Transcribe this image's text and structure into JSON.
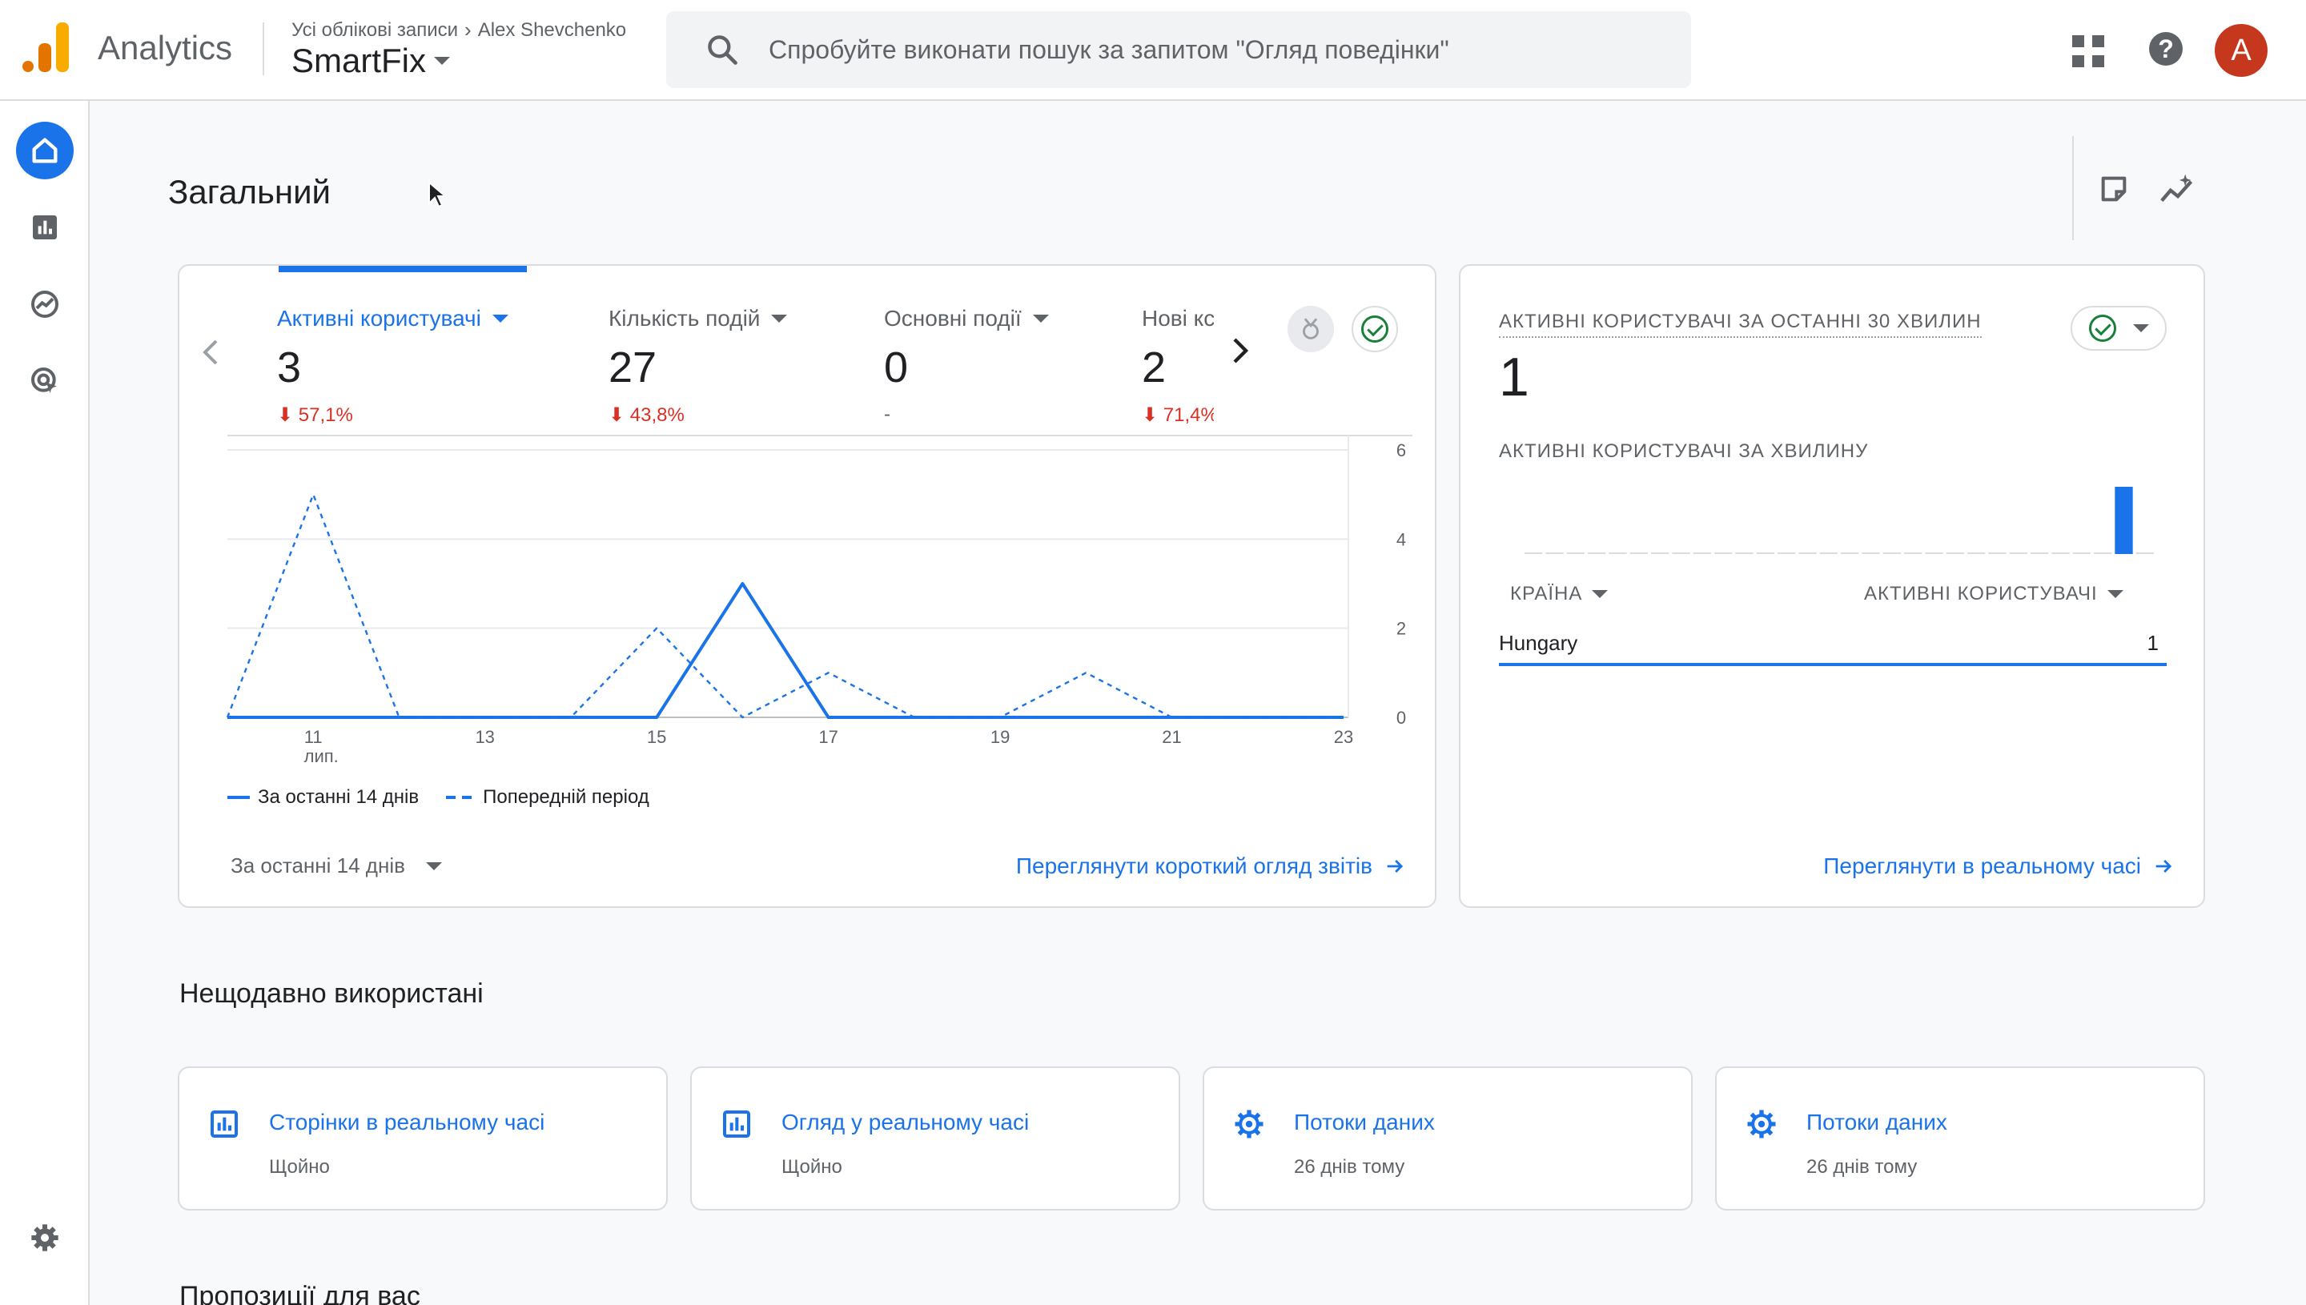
{
  "header": {
    "brand": "Analytics",
    "breadcrumb_all": "Усі облікові записи",
    "breadcrumb_account": "Alex Shevchenko",
    "property": "SmartFix",
    "search_placeholder": "Спробуйте виконати пошук за запитом \"Огляд поведінки\"",
    "avatar_letter": "A"
  },
  "page": {
    "title": "Загальний"
  },
  "metrics": [
    {
      "label": "Активні користувачі",
      "value": "3",
      "delta": "57,1%"
    },
    {
      "label": "Кількість подій",
      "value": "27",
      "delta": "43,8%"
    },
    {
      "label": "Основні події",
      "value": "0",
      "delta": "-"
    },
    {
      "label": "Нові кс",
      "value": "2",
      "delta": "71,4%"
    }
  ],
  "chart_data": {
    "type": "line",
    "x": [
      "10",
      "11",
      "12",
      "13",
      "14",
      "15",
      "16",
      "17",
      "18",
      "19",
      "20",
      "21",
      "22",
      "23"
    ],
    "x_tick_labels": [
      "11",
      "13",
      "15",
      "17",
      "19",
      "21",
      "23"
    ],
    "x_sublabel": "лип.",
    "ylim": [
      0,
      6
    ],
    "y_tick_labels": [
      "0",
      "2",
      "4",
      "6"
    ],
    "series": [
      {
        "name": "За останні 14 днів",
        "style": "solid",
        "values": [
          0,
          0,
          0,
          0,
          0,
          0,
          3,
          0,
          0,
          0,
          0,
          0,
          0,
          0
        ]
      },
      {
        "name": "Попередній період",
        "style": "dashed",
        "values": [
          0,
          5,
          0,
          0,
          0,
          2,
          0,
          1,
          0,
          0,
          1,
          0,
          0,
          0
        ]
      }
    ],
    "grid": true,
    "color": "#1a73e8"
  },
  "legend": {
    "current": "За останні 14 днів",
    "previous": "Попередній період"
  },
  "main_card": {
    "period_label": "За останні 14 днів",
    "report_link": "Переглянути короткий огляд звітів"
  },
  "realtime": {
    "heading": "АКТИВНІ КОРИСТУВАЧІ ЗА ОСТАННІ 30 ХВИЛИН",
    "value": "1",
    "per_minute": "АКТИВНІ КОРИСТУВАЧІ ЗА ХВИЛИНУ",
    "per_minute_bars": [
      0,
      0,
      0,
      0,
      0,
      0,
      0,
      0,
      0,
      0,
      0,
      0,
      0,
      0,
      0,
      0,
      0,
      0,
      0,
      0,
      0,
      0,
      0,
      0,
      0,
      0,
      0,
      0,
      1,
      0
    ],
    "col_country": "КРАЇНА",
    "col_users": "АКТИВНІ КОРИСТУВАЧІ",
    "rows": [
      {
        "country": "Hungary",
        "users": "1"
      }
    ],
    "link": "Переглянути в реальному часі"
  },
  "recent": {
    "title": "Нещодавно використані",
    "items": [
      {
        "title": "Сторінки в реальному часі",
        "sub": "Щойно",
        "icon": "bar-chart-icon"
      },
      {
        "title": "Огляд у реальному часі",
        "sub": "Щойно",
        "icon": "bar-chart-icon"
      },
      {
        "title": "Потоки даних",
        "sub": "26 днів тому",
        "icon": "gear-icon"
      },
      {
        "title": "Потоки даних",
        "sub": "26 днів тому",
        "icon": "gear-icon"
      }
    ]
  },
  "suggestions": {
    "title": "Пропозиції для вас"
  },
  "colors": {
    "accent": "#1a73e8",
    "negative": "#d93025",
    "positive": "#188038",
    "avatar": "#c5381e"
  }
}
